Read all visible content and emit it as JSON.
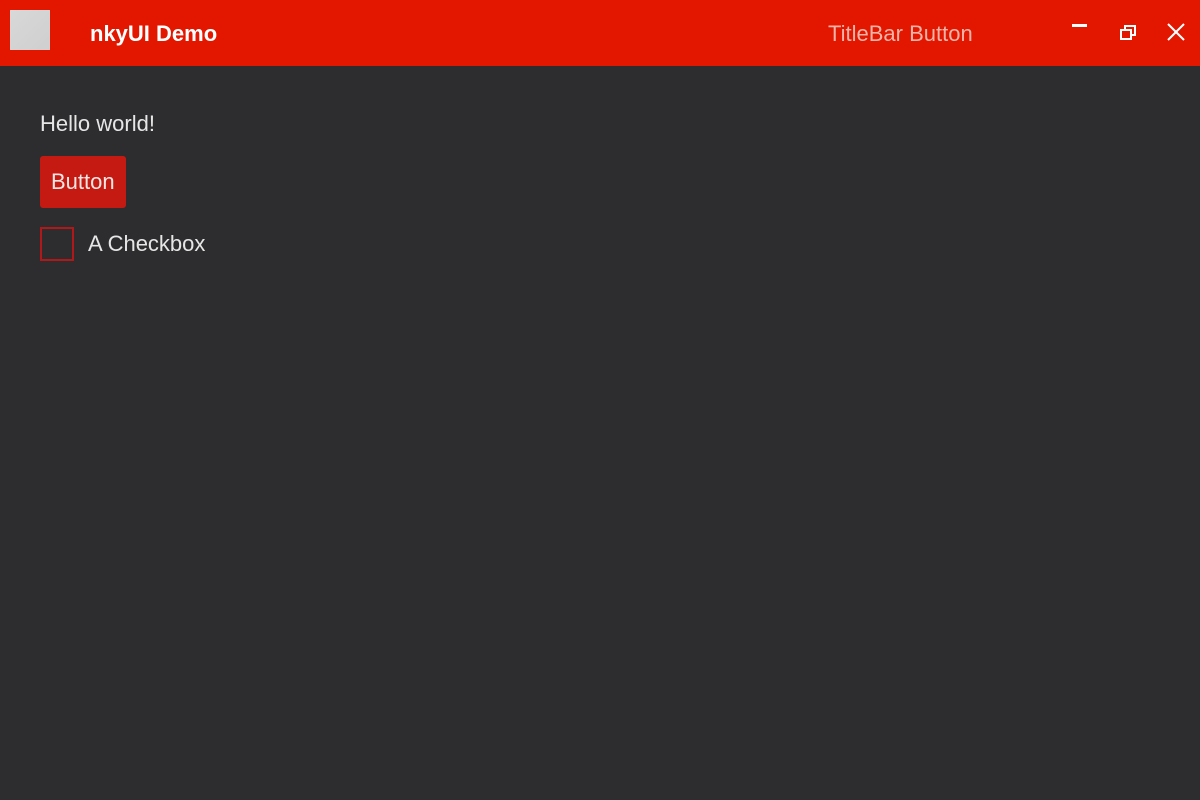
{
  "titlebar": {
    "title": "nkyUI Demo",
    "custom_button_label": "TitleBar Button",
    "accent_color": "#e31600",
    "controls": {
      "minimize_icon": "minimize-icon",
      "maximize_icon": "restore-icon",
      "close_icon": "close-icon"
    },
    "app_icon": "app-icon"
  },
  "main": {
    "greeting": "Hello world!",
    "button_label": "Button",
    "button_color": "#c41a12",
    "checkbox": {
      "label": "A Checkbox",
      "checked": false
    }
  },
  "colors": {
    "background": "#2d2d30",
    "text": "#e6e6e6"
  }
}
